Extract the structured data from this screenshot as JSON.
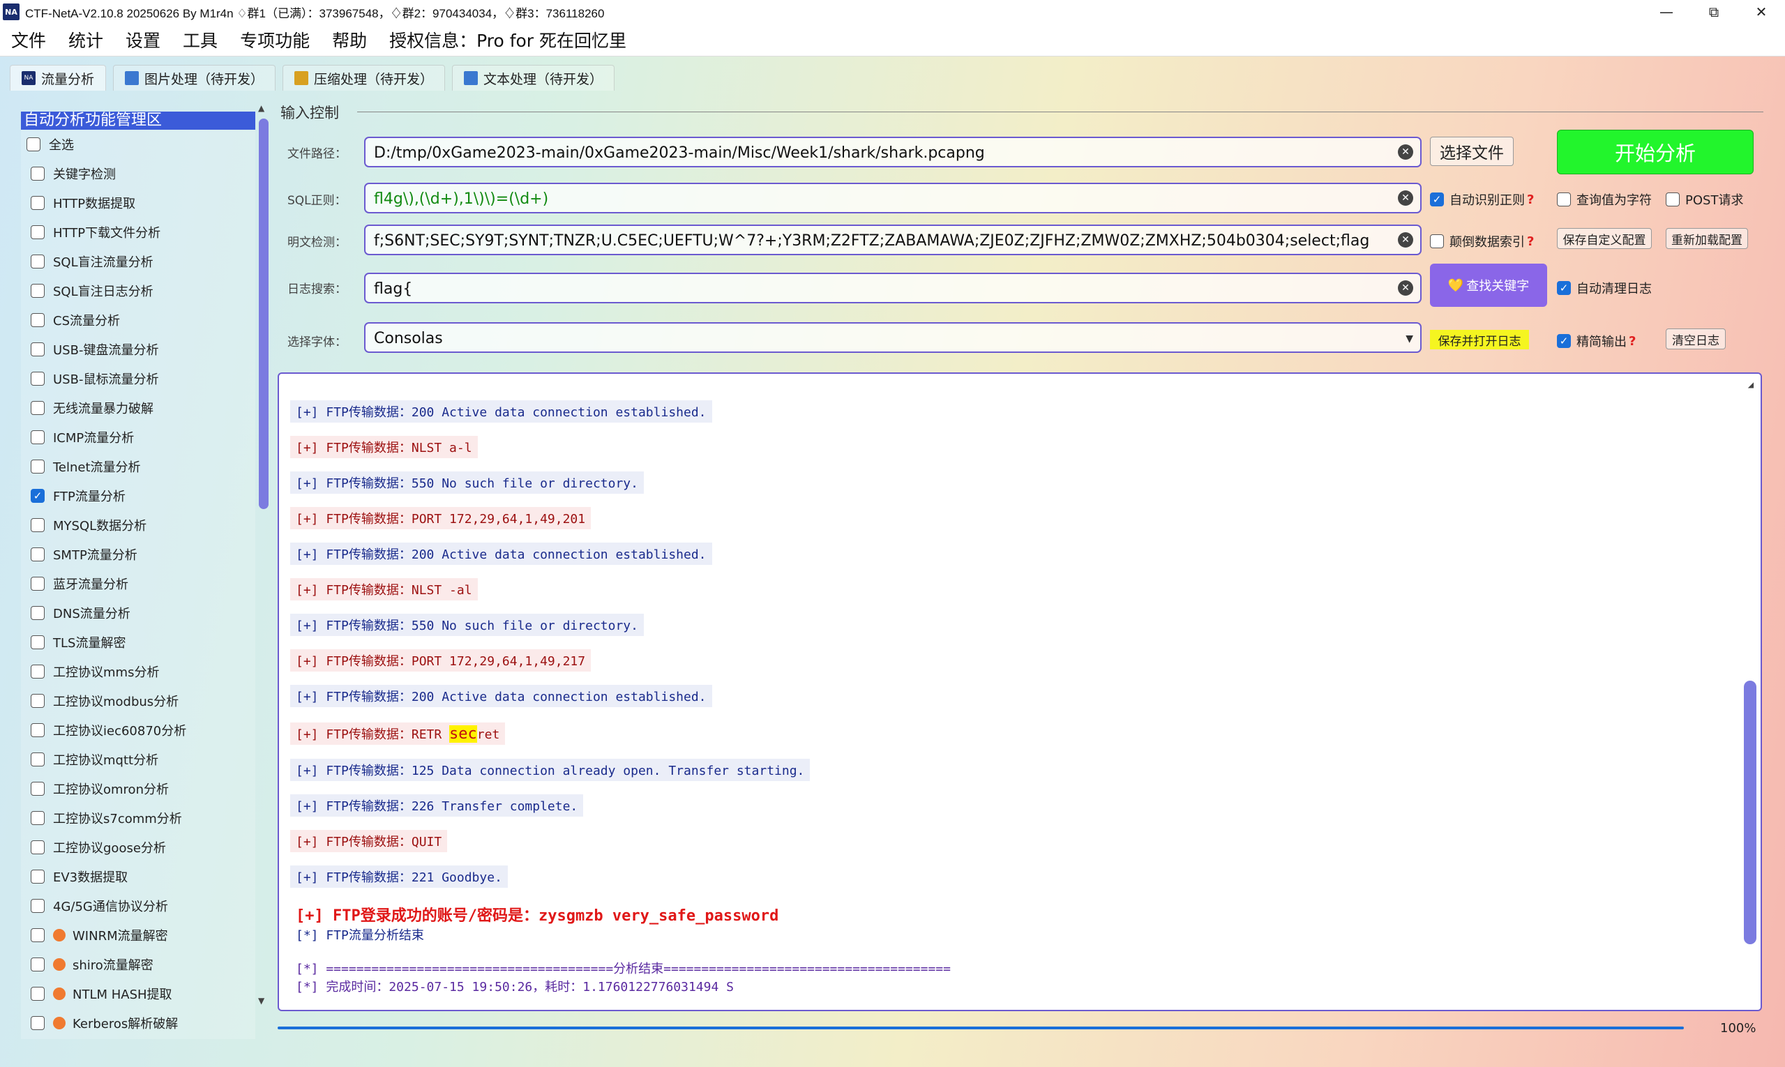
{
  "window": {
    "logo": "NA",
    "title": "CTF-NetA-V2.10.8 20250626 By M1r4n ♢群1（已满）：373967548，♢群2：970434034，♢群3：736118260",
    "minimize": "—",
    "restore": "⧉",
    "close": "✕"
  },
  "menu": [
    "文件",
    "统计",
    "设置",
    "工具",
    "专项功能",
    "帮助",
    "授权信息：Pro for 死在回忆里"
  ],
  "tabs": [
    {
      "label": "流量分析",
      "icon": "NA",
      "color": "#1a2d6e"
    },
    {
      "label": "图片处理（待开发）",
      "icon": "",
      "color": "#3a78d0"
    },
    {
      "label": "压缩处理（待开发）",
      "icon": "",
      "color": "#d8a020"
    },
    {
      "label": "文本处理（待开发）",
      "icon": "",
      "color": "#3a78d0"
    }
  ],
  "sidebar": {
    "title": "自动分析功能管理区",
    "select_all": "全选",
    "items": [
      {
        "label": "关键字检测",
        "checked": false,
        "pro": false
      },
      {
        "label": "HTTP数据提取",
        "checked": false,
        "pro": false
      },
      {
        "label": "HTTP下载文件分析",
        "checked": false,
        "pro": false
      },
      {
        "label": "SQL盲注流量分析",
        "checked": false,
        "pro": false
      },
      {
        "label": "SQL盲注日志分析",
        "checked": false,
        "pro": false
      },
      {
        "label": "CS流量分析",
        "checked": false,
        "pro": false
      },
      {
        "label": "USB-键盘流量分析",
        "checked": false,
        "pro": false
      },
      {
        "label": "USB-鼠标流量分析",
        "checked": false,
        "pro": false
      },
      {
        "label": "无线流量暴力破解",
        "checked": false,
        "pro": false
      },
      {
        "label": "ICMP流量分析",
        "checked": false,
        "pro": false
      },
      {
        "label": "Telnet流量分析",
        "checked": false,
        "pro": false
      },
      {
        "label": "FTP流量分析",
        "checked": true,
        "pro": false
      },
      {
        "label": "MYSQL数据分析",
        "checked": false,
        "pro": false
      },
      {
        "label": "SMTP流量分析",
        "checked": false,
        "pro": false
      },
      {
        "label": "蓝牙流量分析",
        "checked": false,
        "pro": false
      },
      {
        "label": "DNS流量分析",
        "checked": false,
        "pro": false
      },
      {
        "label": "TLS流量解密",
        "checked": false,
        "pro": false
      },
      {
        "label": "工控协议mms分析",
        "checked": false,
        "pro": false
      },
      {
        "label": "工控协议modbus分析",
        "checked": false,
        "pro": false
      },
      {
        "label": "工控协议iec60870分析",
        "checked": false,
        "pro": false
      },
      {
        "label": "工控协议mqtt分析",
        "checked": false,
        "pro": false
      },
      {
        "label": "工控协议omron分析",
        "checked": false,
        "pro": false
      },
      {
        "label": "工控协议s7comm分析",
        "checked": false,
        "pro": false
      },
      {
        "label": "工控协议goose分析",
        "checked": false,
        "pro": false
      },
      {
        "label": "EV3数据提取",
        "checked": false,
        "pro": false
      },
      {
        "label": "4G/5G通信协议分析",
        "checked": false,
        "pro": false
      },
      {
        "label": "WINRM流量解密",
        "checked": false,
        "pro": true
      },
      {
        "label": "shiro流量解密",
        "checked": false,
        "pro": true
      },
      {
        "label": "NTLM HASH提取",
        "checked": false,
        "pro": true
      },
      {
        "label": "Kerberos解析破解",
        "checked": false,
        "pro": true
      }
    ]
  },
  "input": {
    "section_title": "输入控制",
    "file_label": "文件路径：",
    "file_value": "D:/tmp/0xGame2023-main/0xGame2023-main/Misc/Week1/shark/shark.pcapng",
    "sql_label": "SQL正则：",
    "sql_value": "fl4g\\),(\\d+),1\\)\\)=(\\d+)",
    "plain_label": "明文检测：",
    "plain_value": "f;S6NT;SEC;SY9T;SYNT;TNZR;U.C5EC;UEFTU;W^7?+;Y3RM;Z2FTZ;ZABAMAWA;ZJE0Z;ZJFHZ;ZMW0Z;ZMXHZ;504b0304;select;flag",
    "log_label": "日志搜索：",
    "log_value": "flag{",
    "font_label": "选择字体：",
    "font_value": "Consolas",
    "clear_icon": "✕",
    "dropdown_icon": "▼"
  },
  "buttons": {
    "choose_file": "选择文件",
    "start": "开始分析",
    "find_keyword": "查找关键字",
    "find_keyword_icon": "💛",
    "save_config": "保存自定义配置",
    "reload_config": "重新加载配置",
    "save_open_log": "保存并打开日志",
    "clear_log": "清空日志"
  },
  "options": {
    "auto_regex": {
      "label": "自动识别正则",
      "checked": true,
      "help": "?"
    },
    "query_as_char": {
      "label": "查询值为字符",
      "checked": false
    },
    "post_request": {
      "label": "POST请求",
      "checked": false
    },
    "reverse_index": {
      "label": "颠倒数据索引",
      "checked": false,
      "help": "?"
    },
    "auto_clean_log": {
      "label": "自动清理日志",
      "checked": true
    },
    "concise_output": {
      "label": "精简输出",
      "checked": true,
      "help": "?"
    }
  },
  "log": {
    "lines": [
      {
        "text": "[+] FTP传输数据：200 Active data connection established.",
        "style": "blue"
      },
      {
        "text": "[+] FTP传输数据：NLST a-l",
        "style": "red"
      },
      {
        "text": "[+] FTP传输数据：550 No such file or directory.",
        "style": "blue"
      },
      {
        "text": "[+] FTP传输数据：PORT 172,29,64,1,49,201",
        "style": "red"
      },
      {
        "text": "[+] FTP传输数据：200 Active data connection established.",
        "style": "blue"
      },
      {
        "text": "[+] FTP传输数据：NLST -al",
        "style": "red"
      },
      {
        "text": "[+] FTP传输数据：550 No such file or directory.",
        "style": "blue"
      },
      {
        "text": "[+] FTP传输数据：PORT 172,29,64,1,49,217",
        "style": "red"
      },
      {
        "text": "[+] FTP传输数据：200 Active data connection established.",
        "style": "blue"
      },
      {
        "text": "[+] FTP传输数据：RETR ",
        "highlight": "sec",
        "after": "ret",
        "style": "red"
      },
      {
        "text": "[+] FTP传输数据：125 Data connection already open. Transfer starting.",
        "style": "blue"
      },
      {
        "text": "[+] FTP传输数据：226 Transfer complete.",
        "style": "blue"
      },
      {
        "text": "[+] FTP传输数据：QUIT",
        "style": "red"
      },
      {
        "text": "[+] FTP传输数据：221 Goodbye.",
        "style": "blue"
      },
      {
        "text": "[+] FTP登录成功的账号/密码是：zysgmzb very_safe_password",
        "style": "big"
      },
      {
        "text": "[*] FTP流量分析结束",
        "style": "plain"
      },
      {
        "text": "[*] ======================================分析结束======================================",
        "style": "purple"
      },
      {
        "text": "[*] 完成时间：2025-07-15 19:50:26，耗时：1.1760122776031494 S",
        "style": "purple"
      }
    ]
  },
  "progress": {
    "percent_text": "100%",
    "value": 1.0
  }
}
